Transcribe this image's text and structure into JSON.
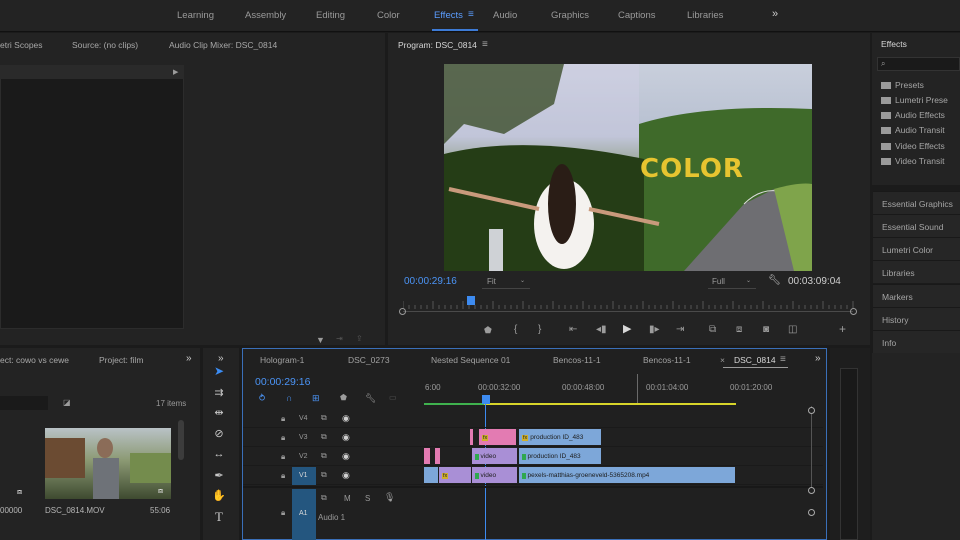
{
  "workspaces": [
    "Learning",
    "Assembly",
    "Editing",
    "Color",
    "Effects",
    "Audio",
    "Graphics",
    "Captions",
    "Libraries"
  ],
  "workspace_active": "Effects",
  "workspace_more": "»",
  "source_tabs": {
    "scopes": "etri Scopes",
    "source": "Source: (no clips)",
    "mixer": "Audio Clip Mixer: DSC_0814"
  },
  "program": {
    "title": "Program: DSC_0814",
    "menu": "≡",
    "timecode": "00:00:29:16",
    "fit": "Fit",
    "quality": "Full",
    "duration": "00:03:09:04",
    "overlay_text": "COLOR",
    "playhead_fraction": 0.15
  },
  "project": {
    "tab1": "ect: cowo vs cewe",
    "tab2": "Project: film",
    "more": "»",
    "items_count": "17 items",
    "clip_name": "DSC_0814.MOV",
    "clip_duration": "55:06",
    "left_timecode": "00000"
  },
  "effects_panel": {
    "title": "Effects",
    "search_placeholder": "",
    "folders": [
      "Presets",
      "Lumetri Prese",
      "Audio Effects",
      "Audio Transit",
      "Video Effects",
      "Video Transit"
    ],
    "sections": [
      "Essential Graphics",
      "Essential Sound",
      "Lumetri Color",
      "Libraries",
      "Markers",
      "History",
      "Info"
    ]
  },
  "timeline": {
    "tabs": [
      "Hologram-1",
      "DSC_0273",
      "Nested Sequence 01",
      "Bencos-11-1",
      "Bencos-11-1",
      "DSC_0814"
    ],
    "active_tab": "DSC_0814",
    "close_glyph": "×",
    "menu": "≡",
    "more": "»",
    "timecode": "00:00:29:16",
    "ruler": [
      "6:00",
      "00:00:32:00",
      "00:00:48:00",
      "00:01:04:00",
      "00:01:20:00"
    ],
    "tracks": [
      "V4",
      "V3",
      "V2",
      "V1"
    ],
    "audio_track": "A1",
    "audio_name": "Audio 1",
    "mute": "M",
    "solo": "S",
    "clips": {
      "v3_a": "fx",
      "v3_b": "production ID_483",
      "v2_a": "video",
      "v2_b": "production ID_483",
      "v1_a": "fx",
      "v1_b": "video",
      "v1_c": "pexels-matthias-groeneveld-5365208.mp4"
    }
  },
  "colors": {
    "accent": "#4b94f6",
    "clip_violet": "#a98fd6",
    "clip_blue": "#7da7d9",
    "clip_pink": "#e37bb2",
    "in_out_bar": "#d7d42a"
  }
}
